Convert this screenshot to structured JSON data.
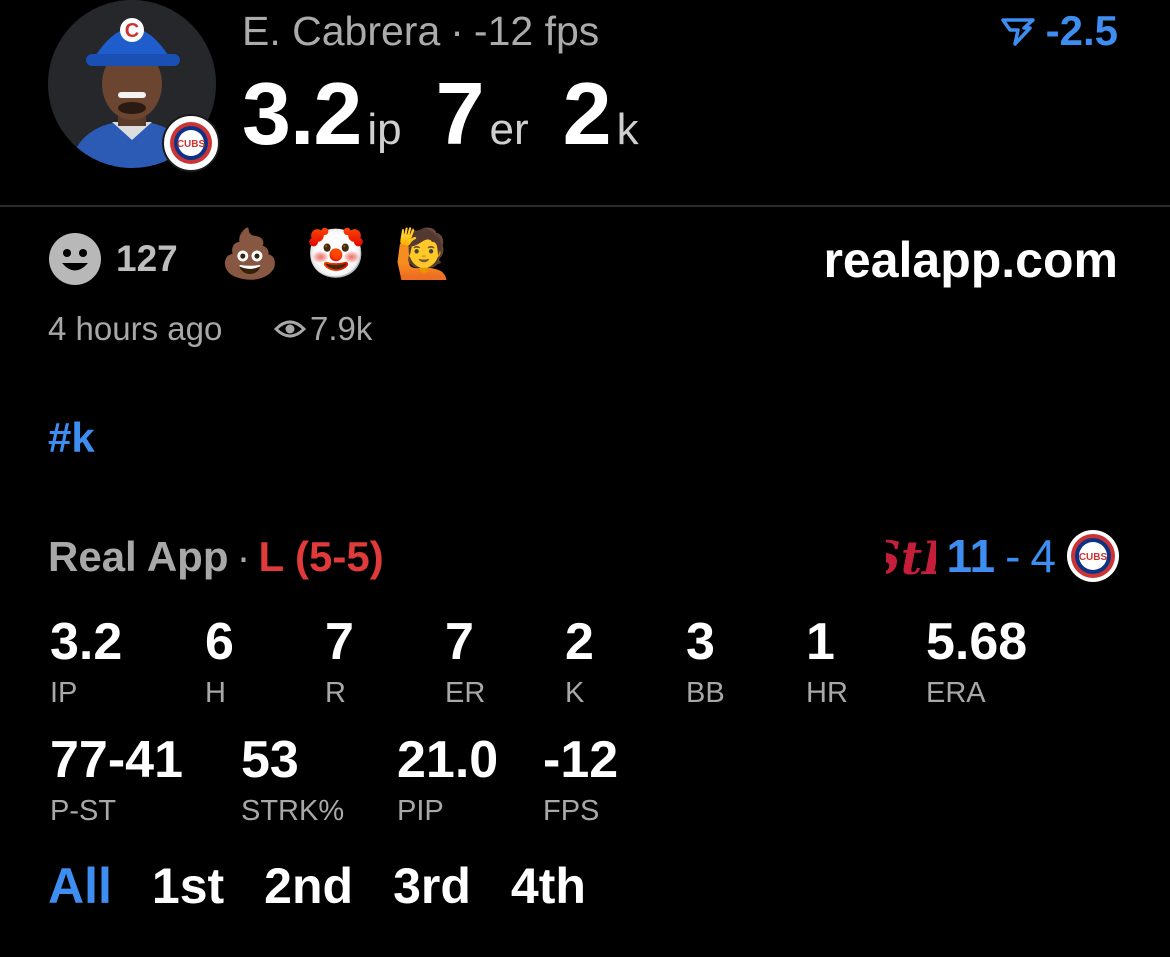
{
  "header": {
    "player_name": "E. Cabrera",
    "separator": "·",
    "fps_text": "-12 fps",
    "stats": [
      {
        "value": "3.2",
        "unit": "ip"
      },
      {
        "value": "7",
        "unit": "er"
      },
      {
        "value": "2",
        "unit": "k"
      }
    ],
    "score_delta": "-2.5",
    "team_badge_text": "CUBS"
  },
  "reactions": {
    "count": "127",
    "emojis": [
      "💩",
      "🤡",
      "🙋"
    ],
    "site": "realapp.com",
    "time_ago": "4 hours ago",
    "views": "7.9k"
  },
  "hashtag": "#k",
  "game": {
    "app_name": "Real App",
    "separator": "·",
    "result": "L (5-5)",
    "opponent_logo": "StL",
    "winning_score": "11",
    "score_dash": "-",
    "losing_score": "4",
    "team_badge_text": "CUBS"
  },
  "stats_row1": [
    {
      "value": "3.2",
      "label": "IP"
    },
    {
      "value": "6",
      "label": "H"
    },
    {
      "value": "7",
      "label": "R"
    },
    {
      "value": "7",
      "label": "ER"
    },
    {
      "value": "2",
      "label": "K"
    },
    {
      "value": "3",
      "label": "BB"
    },
    {
      "value": "1",
      "label": "HR"
    },
    {
      "value": "5.68",
      "label": "ERA"
    }
  ],
  "stats_row2": [
    {
      "value": "77-41",
      "label": "P-ST"
    },
    {
      "value": "53",
      "label": "STRK%"
    },
    {
      "value": "21.0",
      "label": "PIP"
    },
    {
      "value": "-12",
      "label": "FPS"
    }
  ],
  "innings_tabs": [
    "All",
    "1st",
    "2nd",
    "3rd",
    "4th"
  ],
  "colors": {
    "accent": "#3d8ef0",
    "loss": "#e03a3a",
    "cubs_blue": "#0e3386",
    "cubs_red": "#cc3433",
    "cardinals_red": "#c41e3a"
  }
}
